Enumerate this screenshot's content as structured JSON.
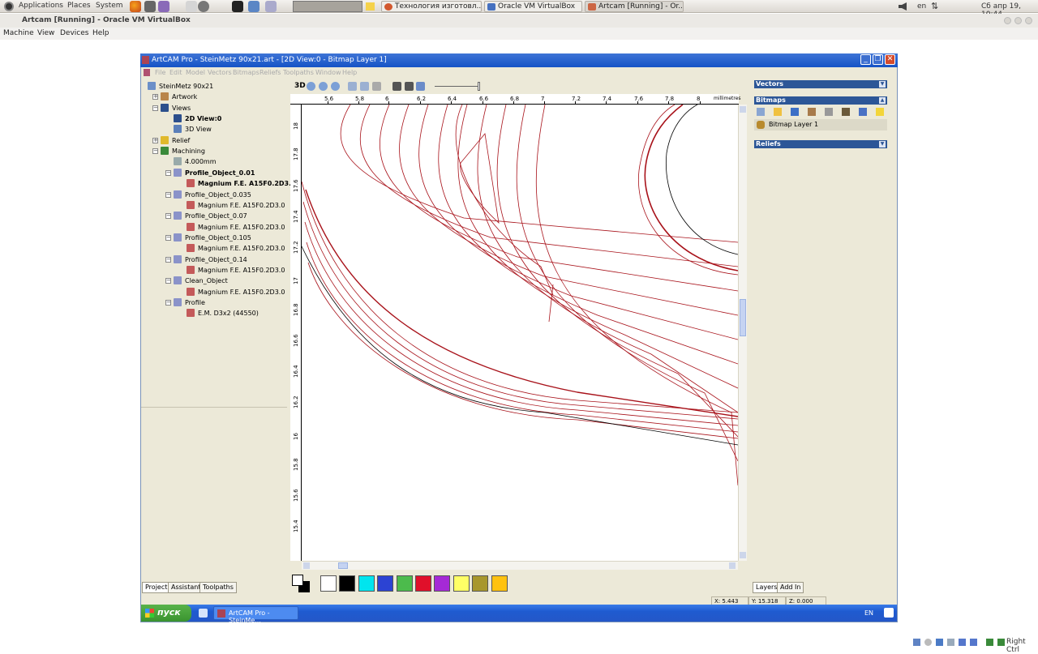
{
  "top_panel": {
    "menus": [
      "Applications",
      "Places",
      "System"
    ],
    "tasks": [
      "Технология изготовл...",
      "Oracle VM VirtualBox",
      "Artcam [Running] - Or..."
    ],
    "lang": "en",
    "clock": "Сб апр 19, 10:44"
  },
  "vbox": {
    "title": "Artcam [Running] - Oracle VM VirtualBox",
    "menu": [
      "Machine",
      "View",
      "Devices",
      "Help"
    ]
  },
  "artcam": {
    "title": "ArtCAM Pro - SteinMetz 90x21.art - [2D View:0 - Bitmap Layer 1]",
    "menu": [
      "File",
      "Edit",
      "Model",
      "Vectors",
      "Bitmaps",
      "Reliefs",
      "Toolpaths",
      "Window",
      "Help"
    ],
    "tree": [
      {
        "label": "SteinMetz 90x21",
        "bold": false
      },
      {
        "label": "Artwork",
        "bold": false
      },
      {
        "label": "Views",
        "bold": false
      },
      {
        "label": "2D View:0",
        "bold": true
      },
      {
        "label": "3D View",
        "bold": false
      },
      {
        "label": "Relief",
        "bold": false
      },
      {
        "label": "Machining",
        "bold": false
      },
      {
        "label": "4.000mm",
        "bold": false
      },
      {
        "label": "Profile_Object_0.01",
        "bold": true
      },
      {
        "label": "Magnium F.E. A15F0.2D3.0",
        "bold": true
      },
      {
        "label": "Profile_Object_0.035",
        "bold": false
      },
      {
        "label": "Magnium F.E. A15F0.2D3.0",
        "bold": false
      },
      {
        "label": "Profile_Object_0.07",
        "bold": false
      },
      {
        "label": "Magnium F.E. A15F0.2D3.0",
        "bold": false
      },
      {
        "label": "Profile_Object_0.105",
        "bold": false
      },
      {
        "label": "Magnium F.E. A15F0.2D3.0",
        "bold": false
      },
      {
        "label": "Profile_Object_0.14",
        "bold": false
      },
      {
        "label": "Magnium F.E. A15F0.2D3.0",
        "bold": false
      },
      {
        "label": "Clean_Object",
        "bold": false
      },
      {
        "label": "Magnium F.E. A15F0.2D3.0",
        "bold": false
      },
      {
        "label": "Profile",
        "bold": false
      },
      {
        "label": "E.M. D3x2 (44550)",
        "bold": false
      }
    ],
    "bottom_tabs": [
      "Project",
      "Assistant",
      "Toolpaths"
    ],
    "view_toolbar_3d": "3D",
    "ruler_top": [
      "5.6",
      "5.8",
      "6",
      "6.2",
      "6.4",
      "6.6",
      "6.8",
      "7",
      "7.2",
      "7.4",
      "7.6",
      "7.8",
      "8"
    ],
    "ruler_unit": "millimetres",
    "ruler_left": [
      "18",
      "17.8",
      "17.6",
      "17.4",
      "17.2",
      "17",
      "16.8",
      "16.6",
      "16.4",
      "16.2",
      "16",
      "15.8",
      "15.6",
      "15.4"
    ],
    "palette": [
      "#ffffff",
      "#000000",
      "#00e5ee",
      "#2c43d3",
      "#4cbb4c",
      "#e0102a",
      "#a52ad6",
      "#ffff66",
      "#a8972c",
      "#ffc20e"
    ],
    "panels": {
      "vectors": "Vectors",
      "bitmaps": "Bitmaps",
      "bitmap_layer": "Bitmap Layer 1",
      "reliefs": "Reliefs"
    },
    "right_tabs": [
      "Layers",
      "Add In"
    ],
    "status": {
      "x": "X: 5.443",
      "y": "Y: 15.318",
      "z": "Z: 0.000"
    }
  },
  "xp_taskbar": {
    "start": "пуск",
    "app": "ArtCAM Pro - SteinMe...",
    "lang": "EN"
  },
  "host_tray": {
    "right_ctrl": "Right Ctrl"
  }
}
